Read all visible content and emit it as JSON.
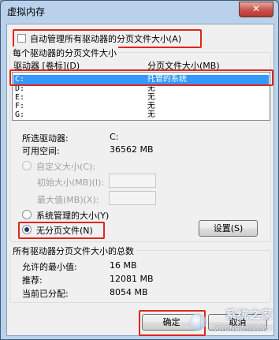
{
  "window": {
    "title": "虚拟内存",
    "close_glyph": "✕"
  },
  "auto_manage": {
    "label": "自动管理所有驱动器的分页文件大小(A)",
    "checked": false
  },
  "drives_group": {
    "label": "每个驱动器的分页文件大小",
    "col_drive": "驱动器 [卷标](D)",
    "col_size": "分页文件大小(MB)",
    "rows": [
      {
        "drive": "C:",
        "size": "托管的系统",
        "selected": true
      },
      {
        "drive": "D:",
        "size": "无",
        "selected": false
      },
      {
        "drive": "E:",
        "size": "无",
        "selected": false
      },
      {
        "drive": "F:",
        "size": "无",
        "selected": false
      },
      {
        "drive": "G:",
        "size": "无",
        "selected": false
      }
    ],
    "selected_drive_label": "所选驱动器:",
    "selected_drive_value": "C:",
    "free_space_label": "可用空间:",
    "free_space_value": "36562 MB",
    "custom_size": {
      "label": "自定义大小(C):",
      "selected": false
    },
    "initial_size": {
      "label": "初始大小(MB)(I):",
      "value": ""
    },
    "max_size": {
      "label": "最大值(MB)(X):",
      "value": ""
    },
    "system_managed": {
      "label": "系统管理的大小(Y)",
      "selected": false
    },
    "no_paging": {
      "label": "无分页文件(N)",
      "selected": true
    },
    "set_button": "设置(S)"
  },
  "totals_group": {
    "label": "所有驱动器分页文件大小的总数",
    "min_label": "允许的最小值:",
    "min_value": "16 MB",
    "recommended_label": "推荐:",
    "recommended_value": "12081 MB",
    "current_label": "当前已分配:",
    "current_value": "8054 MB"
  },
  "buttons": {
    "ok": "确定",
    "cancel": "取消"
  },
  "watermark": {
    "text": "系统之家",
    "url": "XITONGZHIJIA.NET"
  }
}
